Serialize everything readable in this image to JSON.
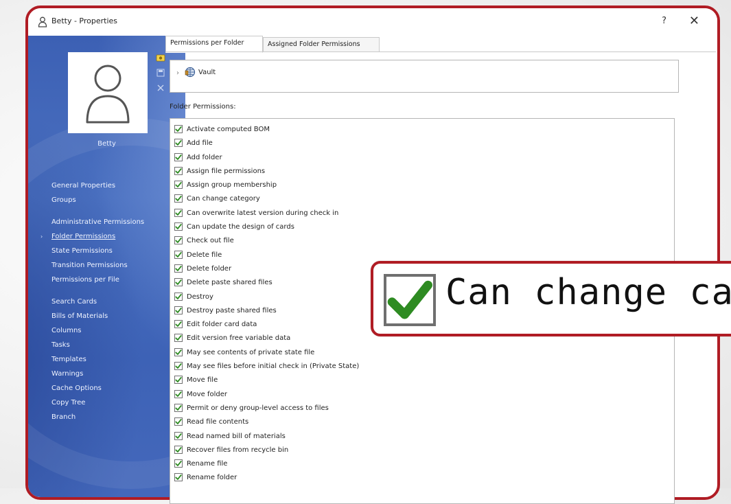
{
  "window": {
    "title": "Betty - Properties",
    "help_label": "?",
    "close_label": "✕"
  },
  "sidebar": {
    "user_name": "Betty",
    "nav_groups": [
      [
        "General Properties",
        "Groups"
      ],
      [
        "Administrative Permissions",
        "Folder Permissions",
        "State Permissions",
        "Transition Permissions",
        "Permissions per File"
      ],
      [
        "Search Cards",
        "Bills of Materials",
        "Columns",
        "Tasks",
        "Templates",
        "Warnings",
        "Cache Options",
        "Copy Tree",
        "Branch"
      ]
    ],
    "active_item": "Folder Permissions"
  },
  "tabs": [
    {
      "label": "Permissions per Folder",
      "selected": true
    },
    {
      "label": "Assigned Folder Permissions",
      "selected": false
    }
  ],
  "tree": {
    "expander": "›",
    "root_label": "Vault"
  },
  "folder_permissions": {
    "label": "Folder Permissions:",
    "items": [
      {
        "label": "Activate computed BOM",
        "checked": true
      },
      {
        "label": "Add file",
        "checked": true
      },
      {
        "label": "Add folder",
        "checked": true
      },
      {
        "label": "Assign file permissions",
        "checked": true
      },
      {
        "label": "Assign group membership",
        "checked": true
      },
      {
        "label": "Can change category",
        "checked": true
      },
      {
        "label": "Can overwrite latest version during check in",
        "checked": true
      },
      {
        "label": "Can update the design of cards",
        "checked": true
      },
      {
        "label": "Check out file",
        "checked": true
      },
      {
        "label": "Delete file",
        "checked": true
      },
      {
        "label": "Delete folder",
        "checked": true
      },
      {
        "label": "Delete paste shared files",
        "checked": true
      },
      {
        "label": "Destroy",
        "checked": true
      },
      {
        "label": "Destroy paste shared files",
        "checked": true
      },
      {
        "label": "Edit folder card data",
        "checked": true
      },
      {
        "label": "Edit version free variable data",
        "checked": true
      },
      {
        "label": "May see contents of private state file",
        "checked": true
      },
      {
        "label": "May see files before initial check in (Private State)",
        "checked": true
      },
      {
        "label": "Move file",
        "checked": true
      },
      {
        "label": "Move folder",
        "checked": true
      },
      {
        "label": "Permit or deny group-level access to files",
        "checked": true
      },
      {
        "label": "Read file contents",
        "checked": true
      },
      {
        "label": "Read named bill of materials",
        "checked": true
      },
      {
        "label": "Recover files from recycle bin",
        "checked": true
      },
      {
        "label": "Rename file",
        "checked": true
      },
      {
        "label": "Rename folder",
        "checked": true
      }
    ]
  },
  "callout": {
    "text": "Can change cat"
  },
  "colors": {
    "accent_red": "#b01c24",
    "sidebar_blue": "#4268b9",
    "check_green": "#2e8b22"
  }
}
